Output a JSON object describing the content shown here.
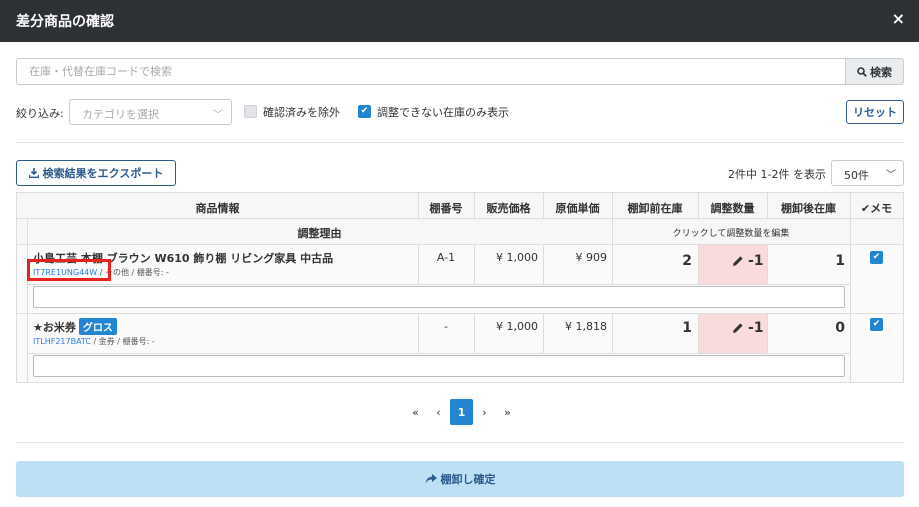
{
  "modal": {
    "title": "差分商品の確認",
    "close_glyph": "×"
  },
  "search": {
    "placeholder": "在庫・代替在庫コードで検索",
    "button_label": "検索"
  },
  "filters": {
    "label": "絞り込み:",
    "category_placeholder": "カテゴリを選択",
    "exclude_confirmed_label": "確認済みを除外",
    "exclude_confirmed_checked": false,
    "only_unadjustable_label": "調整できない在庫のみ表示",
    "only_unadjustable_checked": true,
    "reset_label": "リセット"
  },
  "toolbar": {
    "export_label": "検索結果をエクスポート",
    "count_text": "2件中 1-2件 を表示",
    "per_page": "50件"
  },
  "table": {
    "headers": {
      "product_info": "商品情報",
      "shelf_no": "棚番号",
      "sale_price": "販売価格",
      "cost_price": "原価単価",
      "stock_before": "棚卸前在庫",
      "adjust_qty": "調整数量",
      "stock_after": "棚卸後在庫",
      "memo": "メモ",
      "reason": "調整理由",
      "adjust_hint": "クリックして調整数量を編集"
    },
    "rows": [
      {
        "name": "小島工芸 本棚 ブラウン W610 飾り棚 リビング家具 中古品",
        "code": "IT7RE1UNG44W",
        "meta": " / その他 / 棚番号: -",
        "badge": "",
        "shelf": "A-1",
        "price": "¥ 1,000",
        "cost": "¥ 909",
        "before": "2",
        "adjust": "-1",
        "after": "1",
        "memo_checked": true
      },
      {
        "name": "★お米券",
        "code": "ITLHF217BATC",
        "meta": " / 金券 / 棚番号: -",
        "badge": "グロス",
        "shelf": "-",
        "price": "¥ 1,000",
        "cost": "¥ 1,818",
        "before": "1",
        "adjust": "-1",
        "after": "0",
        "memo_checked": true
      }
    ]
  },
  "pagination": {
    "first": "«",
    "prev": "‹",
    "current": "1",
    "next": "›",
    "last": "»"
  },
  "footer": {
    "confirm_label": "棚卸し確定"
  },
  "colors": {
    "header_bg": "#2d3136",
    "accent": "#2185d0",
    "adjust_bg": "#f9dbdb",
    "confirm_bg": "#bde0f5",
    "highlight": "#e8231f"
  }
}
